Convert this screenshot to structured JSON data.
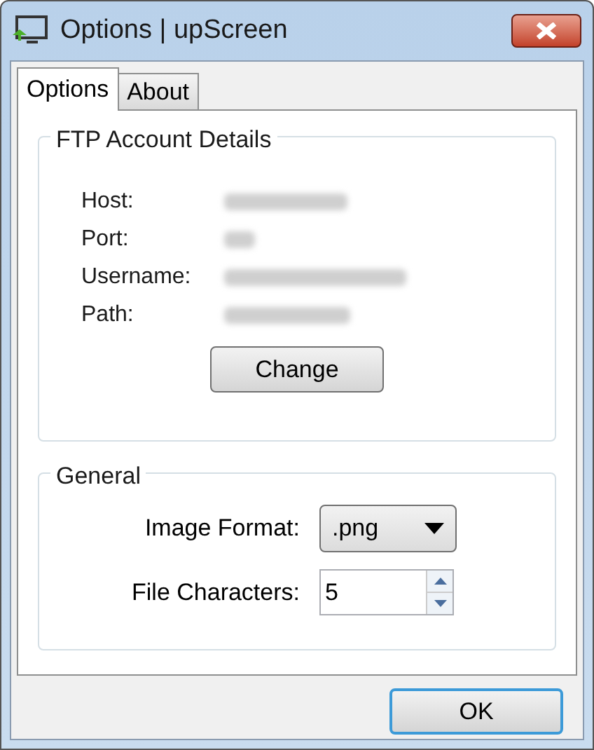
{
  "window": {
    "title": "Options | upScreen"
  },
  "tabs": [
    {
      "label": "Options",
      "selected": true
    },
    {
      "label": "About",
      "selected": false
    }
  ],
  "ftp_group": {
    "title": "FTP Account Details",
    "fields": [
      {
        "label": "Host:",
        "value_blurred": true
      },
      {
        "label": "Port:",
        "value_blurred": true
      },
      {
        "label": "Username:",
        "value_blurred": true
      },
      {
        "label": "Path:",
        "value_blurred": true
      }
    ],
    "button": "Change"
  },
  "general_group": {
    "title": "General",
    "image_format": {
      "label": "Image Format:",
      "value": ".png"
    },
    "file_characters": {
      "label": "File Characters:",
      "value": "5"
    }
  },
  "buttons": [
    "OK"
  ]
}
